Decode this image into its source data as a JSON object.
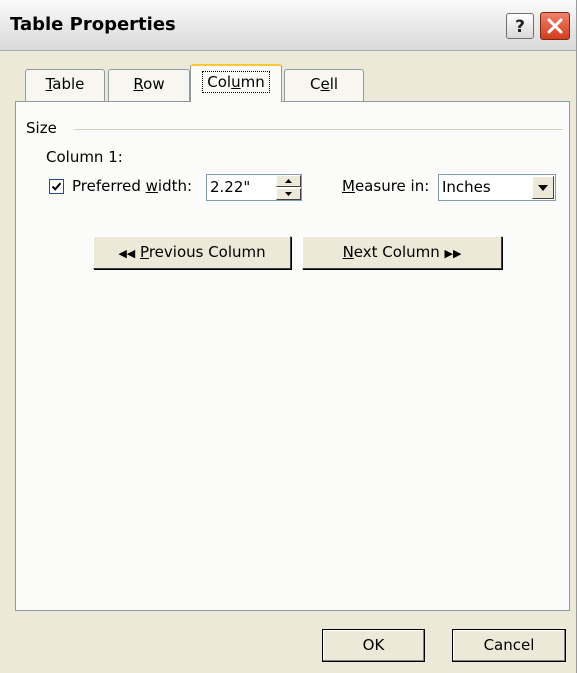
{
  "window": {
    "title": "Table Properties"
  },
  "tabs": [
    {
      "label": "Table",
      "underline": "T"
    },
    {
      "label": "Row",
      "underline": "R"
    },
    {
      "label": "Column",
      "underline": "u"
    },
    {
      "label": "Cell",
      "underline": "e"
    }
  ],
  "size_group": {
    "label": "Size",
    "column_label": "Column 1:",
    "preferred_width": {
      "checked": true,
      "label": "Preferred width:",
      "value": "2.22\""
    },
    "measure_in": {
      "label": "Measure in:",
      "value": "Inches"
    }
  },
  "nav_buttons": {
    "previous": "Previous Column",
    "next": "Next Column"
  },
  "footer": {
    "ok": "OK",
    "cancel": "Cancel"
  },
  "colors": {
    "accent_tab": "#ffc83c",
    "close_button": "#d23c1e",
    "dialog_bg": "#ece9d8"
  }
}
